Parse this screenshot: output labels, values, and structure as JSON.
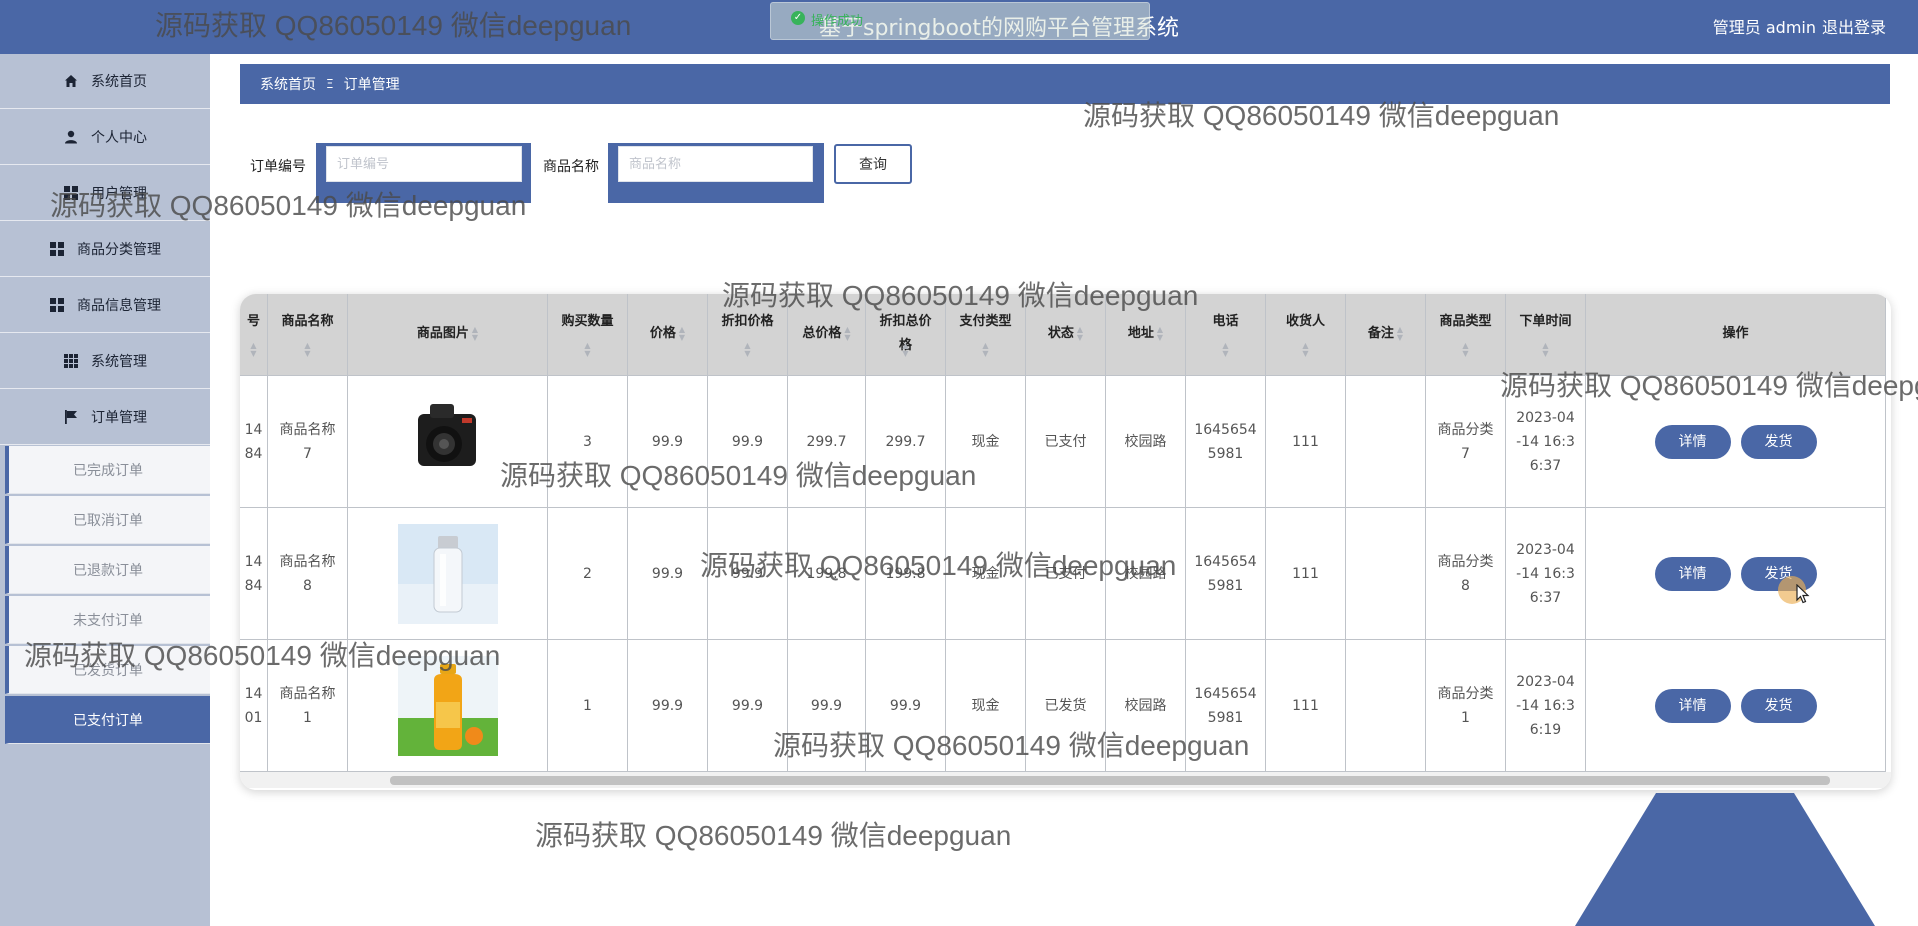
{
  "header": {
    "toast_text": "操作成功",
    "app_title": "基于springboot的网购平台管理系统",
    "user_label": "管理员 admin",
    "logout_label": "退出登录"
  },
  "sidebar": {
    "items": [
      {
        "label": "系统首页",
        "icon": "home-icon"
      },
      {
        "label": "个人中心",
        "icon": "user-icon"
      },
      {
        "label": "用户管理",
        "icon": "grid-icon"
      },
      {
        "label": "商品分类管理",
        "icon": "grid-icon"
      },
      {
        "label": "商品信息管理",
        "icon": "grid-icon"
      },
      {
        "label": "系统管理",
        "icon": "apps-icon"
      },
      {
        "label": "订单管理",
        "icon": "flag-icon"
      }
    ],
    "sub_items": [
      {
        "label": "已完成订单"
      },
      {
        "label": "已取消订单"
      },
      {
        "label": "已退款订单"
      },
      {
        "label": "未支付订单"
      },
      {
        "label": "已发货订单"
      },
      {
        "label": "已支付订单",
        "active": true
      }
    ]
  },
  "breadcrumb": {
    "home": "系统首页",
    "separator": "Ξ",
    "current": "订单管理"
  },
  "search": {
    "order_no_label": "订单编号",
    "order_no_placeholder": "订单编号",
    "order_no_value": "",
    "product_label": "商品名称",
    "product_placeholder": "商品名称",
    "product_value": "",
    "query_label": "查询"
  },
  "table": {
    "columns": [
      {
        "key": "order_no",
        "label": "订单编号",
        "visible_label": "号"
      },
      {
        "key": "name",
        "label": "商品名称"
      },
      {
        "key": "image",
        "label": "商品图片"
      },
      {
        "key": "qty",
        "label": "购买数量"
      },
      {
        "key": "price",
        "label": "价格"
      },
      {
        "key": "discount_price",
        "label": "折扣价格"
      },
      {
        "key": "total",
        "label": "总价格"
      },
      {
        "key": "discount_total",
        "label": "折扣总价格"
      },
      {
        "key": "pay_type",
        "label": "支付类型"
      },
      {
        "key": "status",
        "label": "状态"
      },
      {
        "key": "address",
        "label": "地址"
      },
      {
        "key": "phone",
        "label": "电话"
      },
      {
        "key": "receiver",
        "label": "收货人"
      },
      {
        "key": "remark",
        "label": "备注"
      },
      {
        "key": "category",
        "label": "商品类型"
      },
      {
        "key": "order_time",
        "label": "下单时间"
      },
      {
        "key": "actions",
        "label": "操作"
      }
    ],
    "rows": [
      {
        "order_no": "14\n84",
        "name": "商品名称\n7",
        "image": "camera",
        "qty": "3",
        "price": "99.9",
        "discount_price": "99.9",
        "total": "299.7",
        "discount_total": "299.7",
        "pay_type": "现金",
        "status": "已支付",
        "address": "校园路",
        "phone": "1645654\n5981",
        "receiver": "111",
        "remark": "",
        "category": "商品分类\n7",
        "order_time": "2023-04\n-14 16:3\n6:37"
      },
      {
        "order_no": "14\n84",
        "name": "商品名称\n8",
        "image": "bottle",
        "qty": "2",
        "price": "99.9",
        "discount_price": "99.9",
        "total": "199.8",
        "discount_total": "199.8",
        "pay_type": "现金",
        "status": "已支付",
        "address": "校园路",
        "phone": "1645654\n5981",
        "receiver": "111",
        "remark": "",
        "category": "商品分类\n8",
        "order_time": "2023-04\n-14 16:3\n6:37"
      },
      {
        "order_no": "14\n01",
        "name": "商品名称\n1",
        "image": "juice",
        "qty": "1",
        "price": "99.9",
        "discount_price": "99.9",
        "total": "99.9",
        "discount_total": "99.9",
        "pay_type": "现金",
        "status": "已发货",
        "address": "校园路",
        "phone": "1645654\n5981",
        "receiver": "111",
        "remark": "",
        "category": "商品分类\n1",
        "order_time": "2023-04\n-14 16:3\n6:19"
      }
    ],
    "detail_label": "详情",
    "ship_label": "发货"
  },
  "watermark_text": "源码获取 QQ86050149 微信deepguan",
  "colors": {
    "primary": "#4a67a6",
    "sidebar_bg": "#b7c1d4",
    "header_row_bg": "#d3d3d3",
    "success": "#38b35b"
  }
}
